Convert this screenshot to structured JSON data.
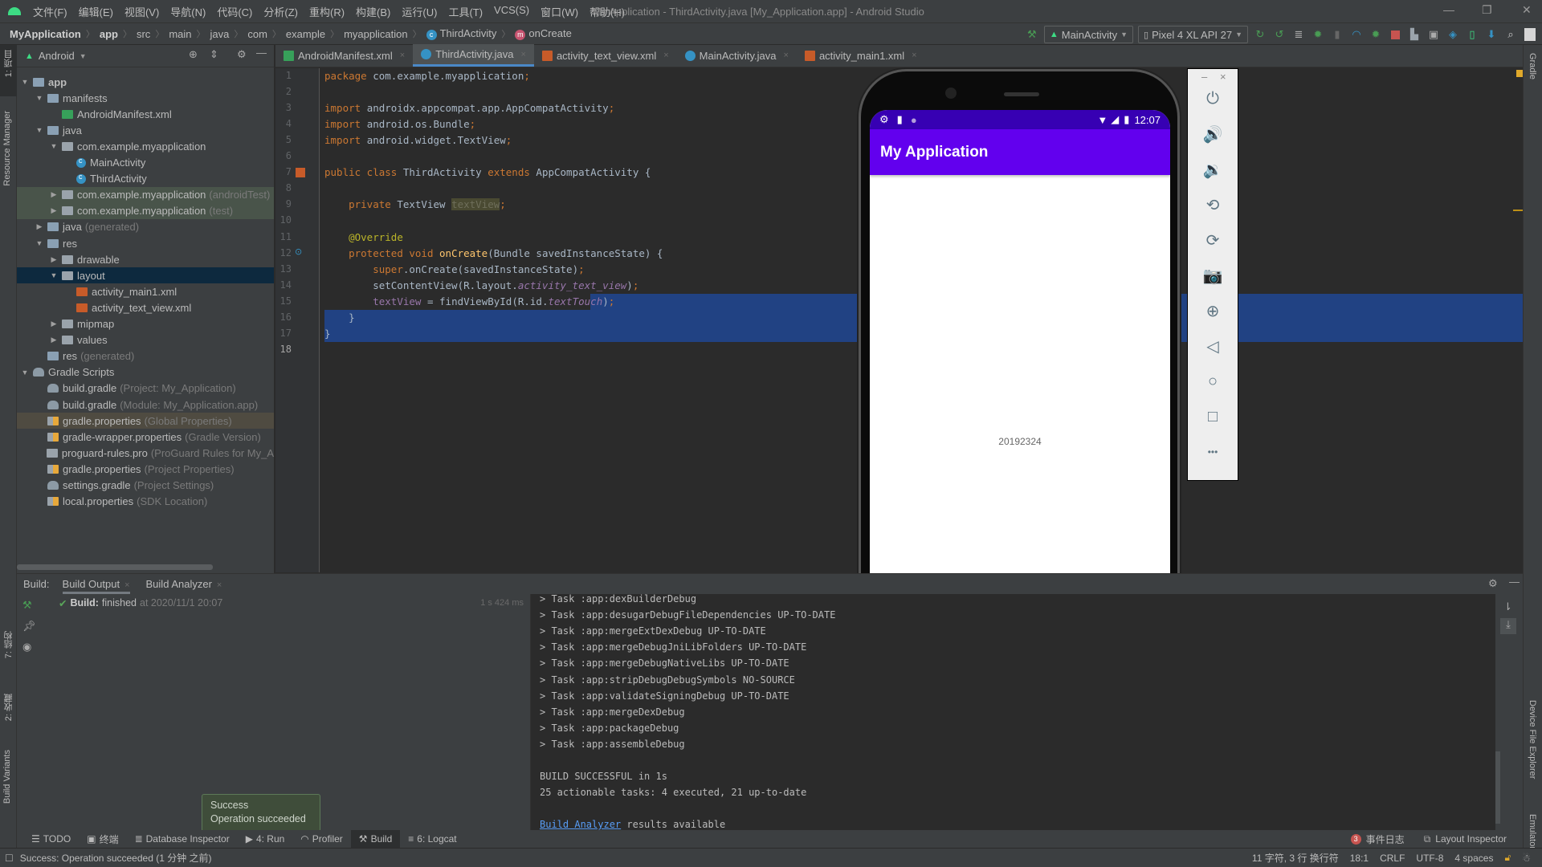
{
  "window": {
    "title": "My Application - ThirdActivity.java [My_Application.app] - Android Studio",
    "controls": [
      "minimize",
      "maximize",
      "close"
    ]
  },
  "menu": [
    "文件(F)",
    "编辑(E)",
    "视图(V)",
    "导航(N)",
    "代码(C)",
    "分析(Z)",
    "重构(R)",
    "构建(B)",
    "运行(U)",
    "工具(T)",
    "VCS(S)",
    "窗口(W)",
    "帮助(H)"
  ],
  "breadcrumb": [
    "MyApplication",
    "app",
    "src",
    "main",
    "java",
    "com",
    "example",
    "myapplication",
    "ThirdActivity",
    "onCreate"
  ],
  "toolbar": {
    "run_config": "MainActivity",
    "device": "Pixel 4 XL API 27",
    "icons": [
      "hammer-icon",
      "apply-changes-restart-icon",
      "apply-code-changes-icon",
      "coverage-icon",
      "debug-icon",
      "attach-icon",
      "profile-icon",
      "attach-debugger-icon",
      "stop-icon",
      "project-structure-icon",
      "sdk-manager-icon",
      "avd-manager-icon",
      "device-manager-icon",
      "sync-icon",
      "search-icon",
      "account-icon"
    ]
  },
  "left_stripe": {
    "project": "1: 项目",
    "resource_manager": "Resource Manager",
    "structure": "7: 结构",
    "favorites": "2: 收藏",
    "build_variants": "Build Variants"
  },
  "right_stripe": {
    "gradle": "Gradle",
    "device_file_explorer": "Device File Explorer",
    "emulator": "Emulator"
  },
  "project_panel": {
    "view_mode": "Android",
    "tree": [
      {
        "label": "app",
        "depth": 0,
        "arrow": "open",
        "icon": "module",
        "bold": true
      },
      {
        "label": "manifests",
        "depth": 1,
        "arrow": "open",
        "icon": "folder"
      },
      {
        "label": "AndroidManifest.xml",
        "depth": 2,
        "arrow": "",
        "icon": "manifest"
      },
      {
        "label": "java",
        "depth": 1,
        "arrow": "open",
        "icon": "folder"
      },
      {
        "label": "com.example.myapplication",
        "depth": 2,
        "arrow": "open",
        "icon": "package"
      },
      {
        "label": "MainActivity",
        "depth": 3,
        "arrow": "",
        "icon": "class"
      },
      {
        "label": "ThirdActivity",
        "depth": 3,
        "arrow": "",
        "icon": "class"
      },
      {
        "label": "com.example.myapplication",
        "hint": "(androidTest)",
        "depth": 2,
        "arrow": "closed",
        "icon": "package",
        "highlight": "test"
      },
      {
        "label": "com.example.myapplication",
        "hint": "(test)",
        "depth": 2,
        "arrow": "closed",
        "icon": "package",
        "highlight": "test"
      },
      {
        "label": "java",
        "hint": "(generated)",
        "depth": 1,
        "arrow": "closed",
        "icon": "folder-gen"
      },
      {
        "label": "res",
        "depth": 1,
        "arrow": "open",
        "icon": "folder-res"
      },
      {
        "label": "drawable",
        "depth": 2,
        "arrow": "closed",
        "icon": "package"
      },
      {
        "label": "layout",
        "depth": 2,
        "arrow": "open",
        "icon": "package",
        "selected": true
      },
      {
        "label": "activity_main1.xml",
        "depth": 3,
        "arrow": "",
        "icon": "xml"
      },
      {
        "label": "activity_text_view.xml",
        "depth": 3,
        "arrow": "",
        "icon": "xml"
      },
      {
        "label": "mipmap",
        "depth": 2,
        "arrow": "closed",
        "icon": "package"
      },
      {
        "label": "values",
        "depth": 2,
        "arrow": "closed",
        "icon": "package"
      },
      {
        "label": "res",
        "hint": "(generated)",
        "depth": 1,
        "arrow": "",
        "icon": "folder-res"
      },
      {
        "label": "Gradle Scripts",
        "depth": 0,
        "arrow": "open",
        "icon": "gradle"
      },
      {
        "label": "build.gradle",
        "hint": "(Project: My_Application)",
        "depth": 1,
        "arrow": "",
        "icon": "gradle"
      },
      {
        "label": "build.gradle",
        "hint": "(Module: My_Application.app)",
        "depth": 1,
        "arrow": "",
        "icon": "gradle"
      },
      {
        "label": "gradle.properties",
        "hint": "(Global Properties)",
        "depth": 1,
        "arrow": "",
        "icon": "properties",
        "highlight": "global"
      },
      {
        "label": "gradle-wrapper.properties",
        "hint": "(Gradle Version)",
        "depth": 1,
        "arrow": "",
        "icon": "properties"
      },
      {
        "label": "proguard-rules.pro",
        "hint": "(ProGuard Rules for My_A",
        "depth": 1,
        "arrow": "",
        "icon": "text"
      },
      {
        "label": "gradle.properties",
        "hint": "(Project Properties)",
        "depth": 1,
        "arrow": "",
        "icon": "properties"
      },
      {
        "label": "settings.gradle",
        "hint": "(Project Settings)",
        "depth": 1,
        "arrow": "",
        "icon": "gradle"
      },
      {
        "label": "local.properties",
        "hint": "(SDK Location)",
        "depth": 1,
        "arrow": "",
        "icon": "properties"
      }
    ]
  },
  "editor": {
    "tabs": [
      {
        "label": "AndroidManifest.xml",
        "icon": "manifest",
        "active": false
      },
      {
        "label": "ThirdActivity.java",
        "icon": "class",
        "active": true
      },
      {
        "label": "activity_text_view.xml",
        "icon": "xml",
        "active": false
      },
      {
        "label": "MainActivity.java",
        "icon": "class",
        "active": false
      },
      {
        "label": "activity_main1.xml",
        "icon": "xml",
        "active": false
      }
    ],
    "current_line": 18,
    "lines": [
      [
        [
          "kw",
          "package "
        ],
        [
          "",
          "com.example.myapplication"
        ],
        [
          "kw",
          ";"
        ]
      ],
      [],
      [
        [
          "kw",
          "import "
        ],
        [
          "",
          "androidx.appcompat.app.AppCompatActivity"
        ],
        [
          "kw",
          ";"
        ]
      ],
      [
        [
          "kw",
          "import "
        ],
        [
          "",
          "android.os.Bundle"
        ],
        [
          "kw",
          ";"
        ]
      ],
      [
        [
          "kw",
          "import "
        ],
        [
          "",
          "android.widget.TextView"
        ],
        [
          "kw",
          ";"
        ]
      ],
      [],
      [
        [
          "kw",
          "public class "
        ],
        [
          "",
          "ThirdActivity "
        ],
        [
          "kw",
          "extends "
        ],
        [
          "",
          "AppCompatActivity {"
        ]
      ],
      [],
      [
        [
          "",
          "    "
        ],
        [
          "kw",
          "private "
        ],
        [
          "",
          "TextView "
        ],
        [
          "unused",
          "textView"
        ],
        [
          "kw",
          ";"
        ]
      ],
      [],
      [
        [
          "",
          "    "
        ],
        [
          "an",
          "@Override"
        ]
      ],
      [
        [
          "",
          "    "
        ],
        [
          "kw",
          "protected void "
        ],
        [
          "fn",
          "onCreate"
        ],
        [
          "",
          "(Bundle savedInstanceState) {"
        ]
      ],
      [
        [
          "",
          "        "
        ],
        [
          "kw",
          "super"
        ],
        [
          "",
          ".onCreate(savedInstanceState)"
        ],
        [
          "kw",
          ";"
        ]
      ],
      [
        [
          "",
          "        setContentView(R.layout."
        ],
        [
          "it",
          "activity_text_view"
        ],
        [
          "",
          ")"
        ],
        [
          "kw",
          ";"
        ]
      ],
      [
        [
          "",
          "        "
        ],
        [
          "fld",
          "textView"
        ],
        [
          "",
          " = findViewById(R.id."
        ],
        [
          "it",
          "textTouch"
        ],
        [
          "",
          ")"
        ],
        [
          "kw",
          ";"
        ]
      ],
      [
        [
          "",
          "    }"
        ]
      ],
      [
        [
          "",
          "}"
        ]
      ],
      []
    ]
  },
  "emulator": {
    "status_time": "12:07",
    "app_title": "My Application",
    "text_view": "20192324",
    "theme_primary": "#6200ee",
    "theme_dark": "#3700b3",
    "side_controls": [
      {
        "name": "power-icon",
        "glyph": "⏻"
      },
      {
        "name": "volume-up-icon",
        "glyph": "🔊"
      },
      {
        "name": "volume-down-icon",
        "glyph": "🔉"
      },
      {
        "name": "rotate-left-icon",
        "glyph": "⟲"
      },
      {
        "name": "rotate-right-icon",
        "glyph": "⟳"
      },
      {
        "name": "screenshot-icon",
        "glyph": "📷"
      },
      {
        "name": "zoom-icon",
        "glyph": "⊕"
      },
      {
        "name": "back-icon",
        "glyph": "◁"
      },
      {
        "name": "home-icon",
        "glyph": "○"
      },
      {
        "name": "overview-icon",
        "glyph": "□"
      },
      {
        "name": "more-icon",
        "glyph": "•••"
      }
    ]
  },
  "build": {
    "label": "Build:",
    "tabs": [
      "Build Output",
      "Build Analyzer"
    ],
    "tree_item": {
      "title": "Build:",
      "status": "finished",
      "time": "at 2020/11/1 20:07",
      "duration": "1 s 424 ms"
    },
    "output": [
      "> Task :app:dexBuilderDebug",
      "> Task :app:desugarDebugFileDependencies UP-TO-DATE",
      "> Task :app:mergeExtDexDebug UP-TO-DATE",
      "> Task :app:mergeDebugJniLibFolders UP-TO-DATE",
      "> Task :app:mergeDebugNativeLibs UP-TO-DATE",
      "> Task :app:stripDebugDebugSymbols NO-SOURCE",
      "> Task :app:validateSigningDebug UP-TO-DATE",
      "> Task :app:mergeDexDebug",
      "> Task :app:packageDebug",
      "> Task :app:assembleDebug",
      "",
      "BUILD SUCCESSFUL in 1s",
      "25 actionable tasks: 4 executed, 21 up-to-date",
      ""
    ],
    "analyzer_link": "Build Analyzer",
    "analyzer_suffix": " results available"
  },
  "balloon": {
    "title": "Success",
    "message": "Operation succeeded"
  },
  "tool_windows": [
    {
      "label": "TODO",
      "icon": "todo-icon"
    },
    {
      "label": "终端",
      "icon": "terminal-icon"
    },
    {
      "label": "Database Inspector",
      "icon": "database-icon"
    },
    {
      "label": "4: Run",
      "icon": "run-icon"
    },
    {
      "label": "Profiler",
      "icon": "profiler-icon"
    },
    {
      "label": "Build",
      "icon": "hammer-icon",
      "active": true
    },
    {
      "label": "6: Logcat",
      "icon": "logcat-icon"
    }
  ],
  "right_tools": {
    "event_log": "事件日志",
    "event_count": "3",
    "layout_inspector": "Layout Inspector"
  },
  "status": {
    "message": "Success: Operation succeeded (1 分钟 之前)",
    "selection": "11 字符, 3 行 换行符",
    "position": "18:1",
    "line_sep": "CRLF",
    "encoding": "UTF-8",
    "indent": "4 spaces"
  }
}
